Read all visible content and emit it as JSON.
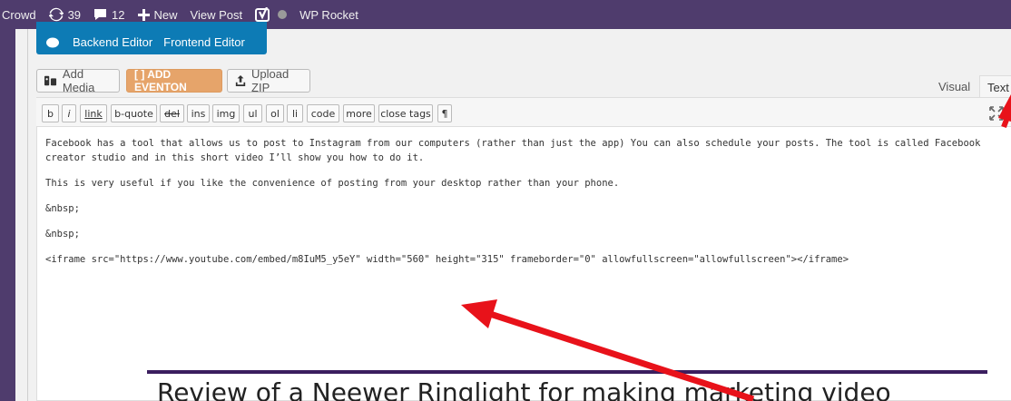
{
  "adminbar": {
    "site": "Crowd",
    "updates_count": "39",
    "comments_count": "12",
    "new_label": "New",
    "view_post": "View Post",
    "rocket": "WP Rocket"
  },
  "wpbakery": {
    "backend": "Backend Editor",
    "frontend": "Frontend Editor"
  },
  "media": {
    "add_media": "Add Media",
    "add_eventon": "[ ] ADD EVENTON",
    "upload_zip": "Upload ZIP"
  },
  "tabs": {
    "visual": "Visual",
    "text": "Text"
  },
  "quicktags": [
    "b",
    "i",
    "link",
    "b-quote",
    "del",
    "ins",
    "img",
    "ul",
    "ol",
    "li",
    "code",
    "more",
    "close tags",
    "¶"
  ],
  "content": {
    "para1": "Facebook has a tool that allows us to post to Instagram from our computers (rather than just the app) You can also schedule your posts. The tool is called Facebook creator studio and in this short video I’ll show you how to do it.",
    "para2": "This is very useful if you like the convenience of posting from your desktop rather than your phone.",
    "nbsp1": "&nbsp;",
    "nbsp2": "&nbsp;",
    "iframe": "<iframe src=\"https://www.youtube.com/embed/m8IuM5_y5eY\" width=\"560\" height=\"315\" frameborder=\"0\" allowfullscreen=\"allowfullscreen\"></iframe>"
  },
  "preview": {
    "title": "Review of a Neewer Ringlight for making marketing video"
  },
  "colors": {
    "adminbar": "#4f3c6d",
    "wpbakery": "#0d7bb5",
    "eventon": "#e6a46a",
    "arrow": "#e8121a"
  }
}
